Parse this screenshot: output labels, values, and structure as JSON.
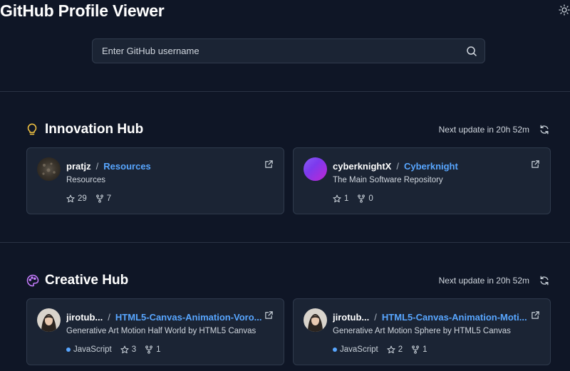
{
  "app": {
    "title": "GitHub Profile Viewer"
  },
  "search": {
    "placeholder": "Enter GitHub username"
  },
  "hubs": [
    {
      "title": "Innovation Hub",
      "next_update": "Next update in 20h 52m",
      "icon": "lightbulb-icon",
      "icon_color": "#f5c542",
      "cards": [
        {
          "owner": "pratjz",
          "repo": "Resources",
          "description": "Resources",
          "stars": "29",
          "forks": "7"
        },
        {
          "owner": "cyberknightX",
          "repo": "Cyberknight",
          "description": "The Main Software Repository",
          "stars": "1",
          "forks": "0"
        }
      ]
    },
    {
      "title": "Creative Hub",
      "next_update": "Next update in 20h 52m",
      "icon": "palette-icon",
      "icon_color": "#c77dff",
      "cards": [
        {
          "owner": "jirotub...",
          "repo": "HTML5-Canvas-Animation-Voro...",
          "description": "Generative Art Motion Half World by HTML5 Canvas",
          "language": "JavaScript",
          "language_color": "#58a6ff",
          "stars": "3",
          "forks": "1"
        },
        {
          "owner": "jirotub...",
          "repo": "HTML5-Canvas-Animation-Moti...",
          "description": "Generative Art Motion Sphere by HTML5 Canvas",
          "language": "JavaScript",
          "language_color": "#58a6ff",
          "stars": "2",
          "forks": "1"
        }
      ]
    }
  ],
  "colors": {
    "background": "#0f1626",
    "card": "#1b2434",
    "link": "#58a6ff"
  }
}
